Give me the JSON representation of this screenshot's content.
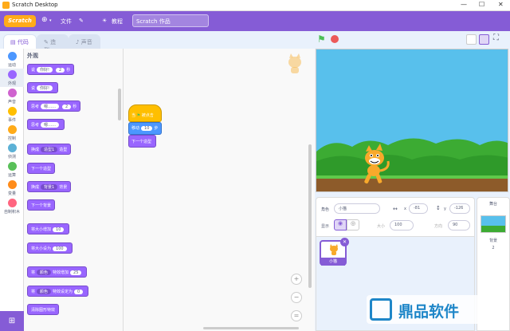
{
  "window": {
    "title": "Scratch Desktop",
    "min": "—",
    "max": "☐",
    "close": "✕"
  },
  "menu": {
    "logo": "Scratch",
    "language": "Scratch Desktop",
    "file": "文件",
    "tutorials": "教程",
    "project_title": "Scratch 作品"
  },
  "tabs": {
    "code": "代码",
    "costumes": "造型",
    "sounds": "声音"
  },
  "categories": [
    {
      "label": "运动",
      "color": "#4c97ff"
    },
    {
      "label": "外观",
      "color": "#9966ff"
    },
    {
      "label": "声音",
      "color": "#cf63cf"
    },
    {
      "label": "事件",
      "color": "#ffbf00"
    },
    {
      "label": "控制",
      "color": "#ffab19"
    },
    {
      "label": "侦测",
      "color": "#5cb1d6"
    },
    {
      "label": "运算",
      "color": "#59c059"
    },
    {
      "label": "变量",
      "color": "#ff8c1a"
    },
    {
      "label": "自制积木",
      "color": "#ff6680"
    }
  ],
  "palette": {
    "heading": "外观",
    "say_for": {
      "word": "说",
      "text": "你好!",
      "secs": "2",
      "unit": "秒"
    },
    "say": {
      "word": "说",
      "text": "你好!"
    },
    "think_for": {
      "word": "思考",
      "text": "嗯……",
      "secs": "2",
      "unit": "秒"
    },
    "think": {
      "word": "思考",
      "text": "嗯……"
    },
    "switch_costume": {
      "word": "换成",
      "value": "造型1",
      "unit": "造型"
    },
    "next_costume": "下一个造型",
    "switch_backdrop": {
      "word": "换成",
      "value": "背景1",
      "unit": "背景"
    },
    "next_backdrop": "下一个背景",
    "change_size": {
      "text": "将大小增加",
      "value": "10"
    },
    "set_size": {
      "text": "将大小设为",
      "value": "100"
    },
    "change_effect": {
      "word": "将",
      "effect": "颜色",
      "text": "特效增加",
      "value": "25"
    },
    "set_effect": {
      "word": "将",
      "effect": "颜色",
      "text": "特效设定为",
      "value": "0"
    },
    "clear_effects": "清除图形特效"
  },
  "script": {
    "hat_prefix": "当",
    "hat_suffix": "被点击",
    "move": "移动",
    "move_value": "10",
    "move_unit": "步",
    "next_costume": "下一个造型"
  },
  "sprite_info": {
    "sprite_label": "角色",
    "sprite_name": "小猫",
    "x_label": "x",
    "x_value": "-81",
    "y_label": "y",
    "y_value": "-126",
    "show_label": "显示",
    "size_label": "大小",
    "size_value": "100",
    "direction_label": "方向",
    "direction_value": "90"
  },
  "sprites": [
    {
      "name": "小猫"
    }
  ],
  "stage_panel": {
    "title": "舞台",
    "backdrops_label": "背景",
    "backdrops_count": "2"
  },
  "watermark": "鼎品软件"
}
